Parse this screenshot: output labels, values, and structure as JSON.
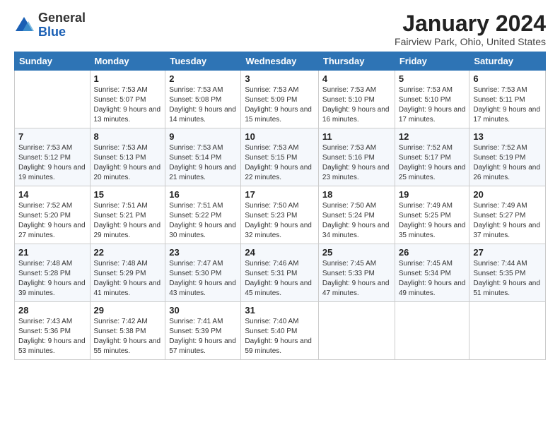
{
  "logo": {
    "general": "General",
    "blue": "Blue"
  },
  "header": {
    "month": "January 2024",
    "location": "Fairview Park, Ohio, United States"
  },
  "days_of_week": [
    "Sunday",
    "Monday",
    "Tuesday",
    "Wednesday",
    "Thursday",
    "Friday",
    "Saturday"
  ],
  "weeks": [
    [
      {
        "day": "",
        "sunrise": "",
        "sunset": "",
        "daylight": ""
      },
      {
        "day": "1",
        "sunrise": "Sunrise: 7:53 AM",
        "sunset": "Sunset: 5:07 PM",
        "daylight": "Daylight: 9 hours and 13 minutes."
      },
      {
        "day": "2",
        "sunrise": "Sunrise: 7:53 AM",
        "sunset": "Sunset: 5:08 PM",
        "daylight": "Daylight: 9 hours and 14 minutes."
      },
      {
        "day": "3",
        "sunrise": "Sunrise: 7:53 AM",
        "sunset": "Sunset: 5:09 PM",
        "daylight": "Daylight: 9 hours and 15 minutes."
      },
      {
        "day": "4",
        "sunrise": "Sunrise: 7:53 AM",
        "sunset": "Sunset: 5:10 PM",
        "daylight": "Daylight: 9 hours and 16 minutes."
      },
      {
        "day": "5",
        "sunrise": "Sunrise: 7:53 AM",
        "sunset": "Sunset: 5:10 PM",
        "daylight": "Daylight: 9 hours and 17 minutes."
      },
      {
        "day": "6",
        "sunrise": "Sunrise: 7:53 AM",
        "sunset": "Sunset: 5:11 PM",
        "daylight": "Daylight: 9 hours and 17 minutes."
      }
    ],
    [
      {
        "day": "7",
        "sunrise": "Sunrise: 7:53 AM",
        "sunset": "Sunset: 5:12 PM",
        "daylight": "Daylight: 9 hours and 19 minutes."
      },
      {
        "day": "8",
        "sunrise": "Sunrise: 7:53 AM",
        "sunset": "Sunset: 5:13 PM",
        "daylight": "Daylight: 9 hours and 20 minutes."
      },
      {
        "day": "9",
        "sunrise": "Sunrise: 7:53 AM",
        "sunset": "Sunset: 5:14 PM",
        "daylight": "Daylight: 9 hours and 21 minutes."
      },
      {
        "day": "10",
        "sunrise": "Sunrise: 7:53 AM",
        "sunset": "Sunset: 5:15 PM",
        "daylight": "Daylight: 9 hours and 22 minutes."
      },
      {
        "day": "11",
        "sunrise": "Sunrise: 7:53 AM",
        "sunset": "Sunset: 5:16 PM",
        "daylight": "Daylight: 9 hours and 23 minutes."
      },
      {
        "day": "12",
        "sunrise": "Sunrise: 7:52 AM",
        "sunset": "Sunset: 5:17 PM",
        "daylight": "Daylight: 9 hours and 25 minutes."
      },
      {
        "day": "13",
        "sunrise": "Sunrise: 7:52 AM",
        "sunset": "Sunset: 5:19 PM",
        "daylight": "Daylight: 9 hours and 26 minutes."
      }
    ],
    [
      {
        "day": "14",
        "sunrise": "Sunrise: 7:52 AM",
        "sunset": "Sunset: 5:20 PM",
        "daylight": "Daylight: 9 hours and 27 minutes."
      },
      {
        "day": "15",
        "sunrise": "Sunrise: 7:51 AM",
        "sunset": "Sunset: 5:21 PM",
        "daylight": "Daylight: 9 hours and 29 minutes."
      },
      {
        "day": "16",
        "sunrise": "Sunrise: 7:51 AM",
        "sunset": "Sunset: 5:22 PM",
        "daylight": "Daylight: 9 hours and 30 minutes."
      },
      {
        "day": "17",
        "sunrise": "Sunrise: 7:50 AM",
        "sunset": "Sunset: 5:23 PM",
        "daylight": "Daylight: 9 hours and 32 minutes."
      },
      {
        "day": "18",
        "sunrise": "Sunrise: 7:50 AM",
        "sunset": "Sunset: 5:24 PM",
        "daylight": "Daylight: 9 hours and 34 minutes."
      },
      {
        "day": "19",
        "sunrise": "Sunrise: 7:49 AM",
        "sunset": "Sunset: 5:25 PM",
        "daylight": "Daylight: 9 hours and 35 minutes."
      },
      {
        "day": "20",
        "sunrise": "Sunrise: 7:49 AM",
        "sunset": "Sunset: 5:27 PM",
        "daylight": "Daylight: 9 hours and 37 minutes."
      }
    ],
    [
      {
        "day": "21",
        "sunrise": "Sunrise: 7:48 AM",
        "sunset": "Sunset: 5:28 PM",
        "daylight": "Daylight: 9 hours and 39 minutes."
      },
      {
        "day": "22",
        "sunrise": "Sunrise: 7:48 AM",
        "sunset": "Sunset: 5:29 PM",
        "daylight": "Daylight: 9 hours and 41 minutes."
      },
      {
        "day": "23",
        "sunrise": "Sunrise: 7:47 AM",
        "sunset": "Sunset: 5:30 PM",
        "daylight": "Daylight: 9 hours and 43 minutes."
      },
      {
        "day": "24",
        "sunrise": "Sunrise: 7:46 AM",
        "sunset": "Sunset: 5:31 PM",
        "daylight": "Daylight: 9 hours and 45 minutes."
      },
      {
        "day": "25",
        "sunrise": "Sunrise: 7:45 AM",
        "sunset": "Sunset: 5:33 PM",
        "daylight": "Daylight: 9 hours and 47 minutes."
      },
      {
        "day": "26",
        "sunrise": "Sunrise: 7:45 AM",
        "sunset": "Sunset: 5:34 PM",
        "daylight": "Daylight: 9 hours and 49 minutes."
      },
      {
        "day": "27",
        "sunrise": "Sunrise: 7:44 AM",
        "sunset": "Sunset: 5:35 PM",
        "daylight": "Daylight: 9 hours and 51 minutes."
      }
    ],
    [
      {
        "day": "28",
        "sunrise": "Sunrise: 7:43 AM",
        "sunset": "Sunset: 5:36 PM",
        "daylight": "Daylight: 9 hours and 53 minutes."
      },
      {
        "day": "29",
        "sunrise": "Sunrise: 7:42 AM",
        "sunset": "Sunset: 5:38 PM",
        "daylight": "Daylight: 9 hours and 55 minutes."
      },
      {
        "day": "30",
        "sunrise": "Sunrise: 7:41 AM",
        "sunset": "Sunset: 5:39 PM",
        "daylight": "Daylight: 9 hours and 57 minutes."
      },
      {
        "day": "31",
        "sunrise": "Sunrise: 7:40 AM",
        "sunset": "Sunset: 5:40 PM",
        "daylight": "Daylight: 9 hours and 59 minutes."
      },
      {
        "day": "",
        "sunrise": "",
        "sunset": "",
        "daylight": ""
      },
      {
        "day": "",
        "sunrise": "",
        "sunset": "",
        "daylight": ""
      },
      {
        "day": "",
        "sunrise": "",
        "sunset": "",
        "daylight": ""
      }
    ]
  ]
}
